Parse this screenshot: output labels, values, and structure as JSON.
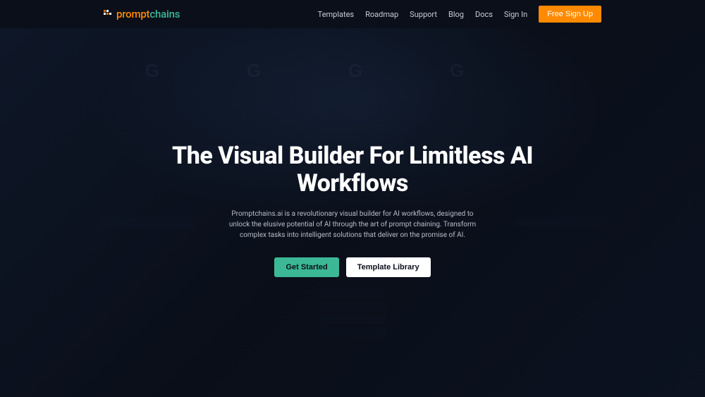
{
  "logo": {
    "part1": "prompt",
    "part2": "chains"
  },
  "nav": {
    "templates": "Templates",
    "roadmap": "Roadmap",
    "support": "Support",
    "blog": "Blog",
    "docs": "Docs",
    "signin": "Sign In",
    "signup": "Free Sign Up"
  },
  "hero": {
    "title": "The Visual Builder For Limitless AI Workflows",
    "subtitle": "Promptchains.ai is a revolutionary visual builder for AI workflows, designed to unlock the elusive potential of AI through the art of prompt chaining. Transform complex tasks into intelligent solutions that deliver on the promise of AI.",
    "cta_primary": "Get Started",
    "cta_secondary": "Template Library"
  }
}
